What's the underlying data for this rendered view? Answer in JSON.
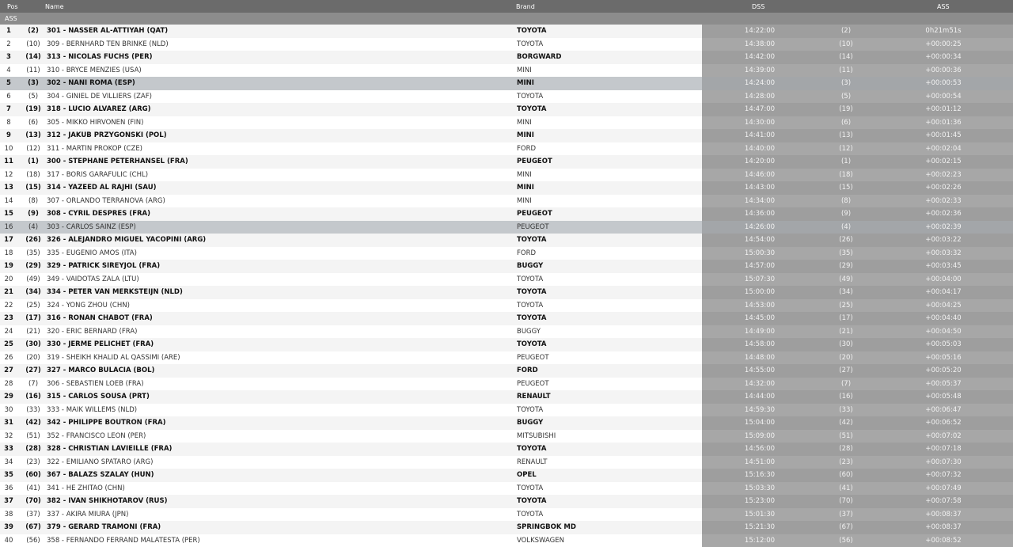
{
  "header": {
    "pos": "Pos",
    "name": "Name",
    "brand": "Brand",
    "dss": "DSS",
    "ass": "ASS"
  },
  "section_label": "ASS",
  "rows": [
    {
      "pos": "1",
      "prev": "(2)",
      "name": "301 - NASSER AL-ATTIYAH (QAT)",
      "brand": "TOYOTA",
      "time": "14:22:00",
      "dprev": "(2)",
      "gap": "0h21m51s",
      "bold": true,
      "hl": false
    },
    {
      "pos": "2",
      "prev": "(10)",
      "name": "309 - BERNHARD TEN BRINKE (NLD)",
      "brand": "TOYOTA",
      "time": "14:38:00",
      "dprev": "(10)",
      "gap": "+00:00:25",
      "bold": false,
      "hl": false
    },
    {
      "pos": "3",
      "prev": "(14)",
      "name": "313 - NICOLAS FUCHS (PER)",
      "brand": "BORGWARD",
      "time": "14:42:00",
      "dprev": "(14)",
      "gap": "+00:00:34",
      "bold": true,
      "hl": false
    },
    {
      "pos": "4",
      "prev": "(11)",
      "name": "310 - BRYCE MENZIES (USA)",
      "brand": "MINI",
      "time": "14:39:00",
      "dprev": "(11)",
      "gap": "+00:00:36",
      "bold": false,
      "hl": false
    },
    {
      "pos": "5",
      "prev": "(3)",
      "name": "302 - NANI ROMA (ESP)",
      "brand": "MINI",
      "time": "14:24:00",
      "dprev": "(3)",
      "gap": "+00:00:53",
      "bold": true,
      "hl": true
    },
    {
      "pos": "6",
      "prev": "(5)",
      "name": "304 - GINIEL DE VILLIERS (ZAF)",
      "brand": "TOYOTA",
      "time": "14:28:00",
      "dprev": "(5)",
      "gap": "+00:00:54",
      "bold": false,
      "hl": false
    },
    {
      "pos": "7",
      "prev": "(19)",
      "name": "318 - LUCIO ALVAREZ (ARG)",
      "brand": "TOYOTA",
      "time": "14:47:00",
      "dprev": "(19)",
      "gap": "+00:01:12",
      "bold": true,
      "hl": false
    },
    {
      "pos": "8",
      "prev": "(6)",
      "name": "305 - MIKKO HIRVONEN (FIN)",
      "brand": "MINI",
      "time": "14:30:00",
      "dprev": "(6)",
      "gap": "+00:01:36",
      "bold": false,
      "hl": false
    },
    {
      "pos": "9",
      "prev": "(13)",
      "name": "312 - JAKUB PRZYGONSKI (POL)",
      "brand": "MINI",
      "time": "14:41:00",
      "dprev": "(13)",
      "gap": "+00:01:45",
      "bold": true,
      "hl": false
    },
    {
      "pos": "10",
      "prev": "(12)",
      "name": "311 - MARTIN PROKOP (CZE)",
      "brand": "FORD",
      "time": "14:40:00",
      "dprev": "(12)",
      "gap": "+00:02:04",
      "bold": false,
      "hl": false
    },
    {
      "pos": "11",
      "prev": "(1)",
      "name": "300 - STEPHANE PETERHANSEL (FRA)",
      "brand": "PEUGEOT",
      "time": "14:20:00",
      "dprev": "(1)",
      "gap": "+00:02:15",
      "bold": true,
      "hl": false
    },
    {
      "pos": "12",
      "prev": "(18)",
      "name": "317 - BORIS GARAFULIC (CHL)",
      "brand": "MINI",
      "time": "14:46:00",
      "dprev": "(18)",
      "gap": "+00:02:23",
      "bold": false,
      "hl": false
    },
    {
      "pos": "13",
      "prev": "(15)",
      "name": "314 - YAZEED AL RAJHI (SAU)",
      "brand": "MINI",
      "time": "14:43:00",
      "dprev": "(15)",
      "gap": "+00:02:26",
      "bold": true,
      "hl": false
    },
    {
      "pos": "14",
      "prev": "(8)",
      "name": "307 - ORLANDO TERRANOVA (ARG)",
      "brand": "MINI",
      "time": "14:34:00",
      "dprev": "(8)",
      "gap": "+00:02:33",
      "bold": false,
      "hl": false
    },
    {
      "pos": "15",
      "prev": "(9)",
      "name": "308 - CYRIL DESPRES (FRA)",
      "brand": "PEUGEOT",
      "time": "14:36:00",
      "dprev": "(9)",
      "gap": "+00:02:36",
      "bold": true,
      "hl": false
    },
    {
      "pos": "16",
      "prev": "(4)",
      "name": "303 - CARLOS SAINZ (ESP)",
      "brand": "PEUGEOT",
      "time": "14:26:00",
      "dprev": "(4)",
      "gap": "+00:02:39",
      "bold": false,
      "hl": true
    },
    {
      "pos": "17",
      "prev": "(26)",
      "name": "326 - ALEJANDRO MIGUEL YACOPINI (ARG)",
      "brand": "TOYOTA",
      "time": "14:54:00",
      "dprev": "(26)",
      "gap": "+00:03:22",
      "bold": true,
      "hl": false
    },
    {
      "pos": "18",
      "prev": "(35)",
      "name": "335 - EUGENIO AMOS (ITA)",
      "brand": "FORD",
      "time": "15:00:30",
      "dprev": "(35)",
      "gap": "+00:03:32",
      "bold": false,
      "hl": false
    },
    {
      "pos": "19",
      "prev": "(29)",
      "name": "329 - PATRICK SIREYJOL (FRA)",
      "brand": "BUGGY",
      "time": "14:57:00",
      "dprev": "(29)",
      "gap": "+00:03:45",
      "bold": true,
      "hl": false
    },
    {
      "pos": "20",
      "prev": "(49)",
      "name": "349 - VAIDOTAS ZALA (LTU)",
      "brand": "TOYOTA",
      "time": "15:07:30",
      "dprev": "(49)",
      "gap": "+00:04:00",
      "bold": false,
      "hl": false
    },
    {
      "pos": "21",
      "prev": "(34)",
      "name": "334 - PETER VAN MERKSTEIJN (NLD)",
      "brand": "TOYOTA",
      "time": "15:00:00",
      "dprev": "(34)",
      "gap": "+00:04:17",
      "bold": true,
      "hl": false
    },
    {
      "pos": "22",
      "prev": "(25)",
      "name": "324 - YONG ZHOU (CHN)",
      "brand": "TOYOTA",
      "time": "14:53:00",
      "dprev": "(25)",
      "gap": "+00:04:25",
      "bold": false,
      "hl": false
    },
    {
      "pos": "23",
      "prev": "(17)",
      "name": "316 - RONAN CHABOT (FRA)",
      "brand": "TOYOTA",
      "time": "14:45:00",
      "dprev": "(17)",
      "gap": "+00:04:40",
      "bold": true,
      "hl": false
    },
    {
      "pos": "24",
      "prev": "(21)",
      "name": "320 - ERIC BERNARD (FRA)",
      "brand": "BUGGY",
      "time": "14:49:00",
      "dprev": "(21)",
      "gap": "+00:04:50",
      "bold": false,
      "hl": false
    },
    {
      "pos": "25",
      "prev": "(30)",
      "name": "330 - JERME PELICHET (FRA)",
      "brand": "TOYOTA",
      "time": "14:58:00",
      "dprev": "(30)",
      "gap": "+00:05:03",
      "bold": true,
      "hl": false
    },
    {
      "pos": "26",
      "prev": "(20)",
      "name": "319 - SHEIKH KHALID AL QASSIMI (ARE)",
      "brand": "PEUGEOT",
      "time": "14:48:00",
      "dprev": "(20)",
      "gap": "+00:05:16",
      "bold": false,
      "hl": false
    },
    {
      "pos": "27",
      "prev": "(27)",
      "name": "327 - MARCO BULACIA (BOL)",
      "brand": "FORD",
      "time": "14:55:00",
      "dprev": "(27)",
      "gap": "+00:05:20",
      "bold": true,
      "hl": false
    },
    {
      "pos": "28",
      "prev": "(7)",
      "name": "306 - SEBASTIEN LOEB (FRA)",
      "brand": "PEUGEOT",
      "time": "14:32:00",
      "dprev": "(7)",
      "gap": "+00:05:37",
      "bold": false,
      "hl": false
    },
    {
      "pos": "29",
      "prev": "(16)",
      "name": "315 - CARLOS SOUSA (PRT)",
      "brand": "RENAULT",
      "time": "14:44:00",
      "dprev": "(16)",
      "gap": "+00:05:48",
      "bold": true,
      "hl": false
    },
    {
      "pos": "30",
      "prev": "(33)",
      "name": "333 - MAIK WILLEMS (NLD)",
      "brand": "TOYOTA",
      "time": "14:59:30",
      "dprev": "(33)",
      "gap": "+00:06:47",
      "bold": false,
      "hl": false
    },
    {
      "pos": "31",
      "prev": "(42)",
      "name": "342 - PHILIPPE BOUTRON (FRA)",
      "brand": "BUGGY",
      "time": "15:04:00",
      "dprev": "(42)",
      "gap": "+00:06:52",
      "bold": true,
      "hl": false
    },
    {
      "pos": "32",
      "prev": "(51)",
      "name": "352 - FRANCISCO LEON (PER)",
      "brand": "MITSUBISHI",
      "time": "15:09:00",
      "dprev": "(51)",
      "gap": "+00:07:02",
      "bold": false,
      "hl": false
    },
    {
      "pos": "33",
      "prev": "(28)",
      "name": "328 - CHRISTIAN LAVIEILLE (FRA)",
      "brand": "TOYOTA",
      "time": "14:56:00",
      "dprev": "(28)",
      "gap": "+00:07:18",
      "bold": true,
      "hl": false
    },
    {
      "pos": "34",
      "prev": "(23)",
      "name": "322 - EMILIANO SPATARO (ARG)",
      "brand": "RENAULT",
      "time": "14:51:00",
      "dprev": "(23)",
      "gap": "+00:07:30",
      "bold": false,
      "hl": false
    },
    {
      "pos": "35",
      "prev": "(60)",
      "name": "367 - BALAZS SZALAY (HUN)",
      "brand": "OPEL",
      "time": "15:16:30",
      "dprev": "(60)",
      "gap": "+00:07:32",
      "bold": true,
      "hl": false
    },
    {
      "pos": "36",
      "prev": "(41)",
      "name": "341 - HE ZHITAO (CHN)",
      "brand": "TOYOTA",
      "time": "15:03:30",
      "dprev": "(41)",
      "gap": "+00:07:49",
      "bold": false,
      "hl": false
    },
    {
      "pos": "37",
      "prev": "(70)",
      "name": "382 - IVAN SHIKHOTAROV (RUS)",
      "brand": "TOYOTA",
      "time": "15:23:00",
      "dprev": "(70)",
      "gap": "+00:07:58",
      "bold": true,
      "hl": false
    },
    {
      "pos": "38",
      "prev": "(37)",
      "name": "337 - AKIRA MIURA (JPN)",
      "brand": "TOYOTA",
      "time": "15:01:30",
      "dprev": "(37)",
      "gap": "+00:08:37",
      "bold": false,
      "hl": false
    },
    {
      "pos": "39",
      "prev": "(67)",
      "name": "379 - GERARD TRAMONI (FRA)",
      "brand": "SPRINGBOK MD",
      "time": "15:21:30",
      "dprev": "(67)",
      "gap": "+00:08:37",
      "bold": true,
      "hl": false
    },
    {
      "pos": "40",
      "prev": "(56)",
      "name": "358 - FERNANDO FERRAND MALATESTA (PER)",
      "brand": "VOLKSWAGEN",
      "time": "15:12:00",
      "dprev": "(56)",
      "gap": "+00:08:52",
      "bold": false,
      "hl": false
    }
  ]
}
